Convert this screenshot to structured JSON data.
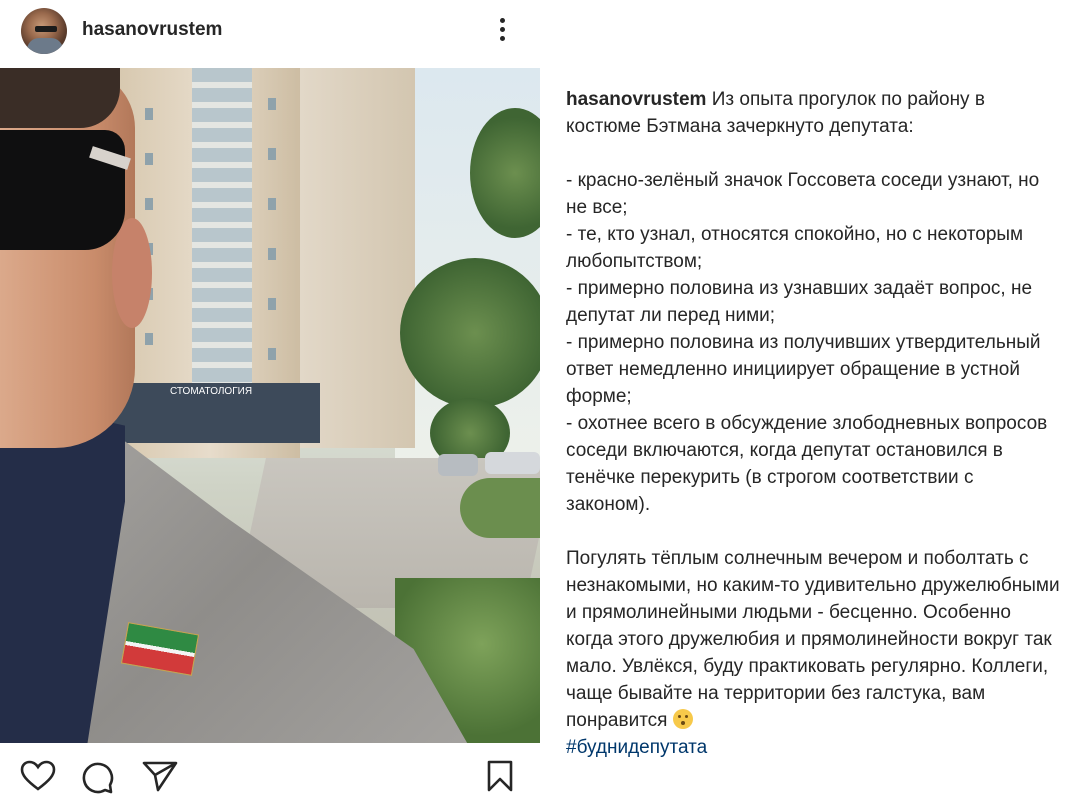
{
  "post": {
    "username": "hasanovrustem",
    "caption_lead": "Из опыта прогулок по району в костюме  Бэтмана зачеркнуто депутата:",
    "caption_body": "- красно-зелёный значок Госсовета соседи узнают, но не все;\n- те, кто узнал, относятся спокойно, но с некоторым любопытством;\n- примерно половина из узнавших задаёт вопрос, не депутат ли перед ними;\n- примерно половина из получивших утвердительный ответ немедленно инициирует обращение в устной форме;\n- охотнее всего в обсуждение злободневных вопросов соседи включаются, когда депутат остановился в тенёчке перекурить (в строгом соответствии с законом).",
    "caption_end": "Погулять тёплым солнечным вечером и поболтать с незнакомыми, но каким-то удивительно дружелюбными и прямолинейными людьми - бесценно. Особенно когда этого дружелюбия и прямолинейности вокруг так мало. Увлёкся, буду практиковать регулярно. Коллеги, чаще бывайте на территории без галстука, вам понравится",
    "emoji": "hushed-face-emoji",
    "hashtag": "#буднидепутата"
  },
  "photo_sign": "СТОМАТОЛОГИЯ",
  "icons": {
    "more": "more-options-icon",
    "like": "heart-icon",
    "comment": "comment-icon",
    "share": "send-icon",
    "save": "bookmark-icon"
  },
  "colors": {
    "text": "#262626",
    "hashtag": "#00376b"
  }
}
